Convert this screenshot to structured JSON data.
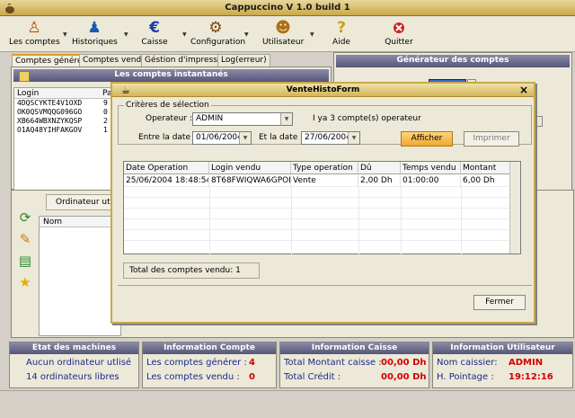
{
  "app": {
    "title": "Cappuccino V 1.0 build 1"
  },
  "toolbar": {
    "items": [
      {
        "label": "Les comptes",
        "icon": "people-icon"
      },
      {
        "label": "Historiques",
        "icon": "history-icon"
      },
      {
        "label": "Caisse",
        "icon": "euro-icon"
      },
      {
        "label": "Configuration",
        "icon": "config-icon"
      },
      {
        "label": "Utilisateur",
        "icon": "user-icon"
      },
      {
        "label": "Aide",
        "icon": "help-icon"
      },
      {
        "label": "Quitter",
        "icon": "quit-icon"
      }
    ]
  },
  "left_tabs": [
    "Comptes générer",
    "Comptes vendu",
    "Géstion d'impression",
    "Log(erreur)"
  ],
  "accounts_panel": {
    "title": "Les comptes instantanés",
    "columns": [
      "Login",
      "Pa"
    ],
    "rows": [
      "4DQSCYKTE4V1OXD",
      "OK0QSVMQQG096GO",
      "XB664WBXNZYKQSP",
      "O1AQ48YIHFAKGOV"
    ],
    "pass_fragments": [
      "9",
      "0",
      "2",
      "1"
    ]
  },
  "generator_panel": {
    "title": "Générateur des comptes"
  },
  "machines_panel": {
    "tab": "Ordinateur utilisé",
    "column": "Nom"
  },
  "status": {
    "machines": {
      "title": "Etat des machines",
      "line1": "Aucun ordinateur utlisé",
      "line2": "14 ordinateurs libres"
    },
    "compte": {
      "title": "Information Compte",
      "label1": "Les comptes générer :",
      "value1": "4",
      "label2": "Les comptes vendu :",
      "value2": "0"
    },
    "caisse": {
      "title": "Information Caisse",
      "label1": "Total Montant caisse :",
      "value1": "00,00 Dh",
      "label2": "Total Crédit :",
      "value2": "00,00 Dh"
    },
    "utilisateur": {
      "title": "Information Utilisateur",
      "label1": "Nom caissier:",
      "value1": "ADMIN",
      "label2": "H. Pointage :",
      "value2": "19:12:16"
    }
  },
  "dialog": {
    "title": "VenteHistoForm",
    "criteria_legend": "Critères de sélection",
    "operator_label": "Operateur :",
    "operator_value": "ADMIN",
    "operator_info": "I ya 3 compte(s) operateur",
    "from_label": "Entre la date :",
    "from_value": "01/06/2004",
    "to_label": "Et la date :",
    "to_value": "27/06/2004",
    "show_button": "Afficher",
    "print_button": "Imprimer",
    "columns": [
      "Date Operation",
      "Login vendu",
      "Type operation",
      "Dû",
      "Temps vendu",
      "Montant"
    ],
    "rows": [
      [
        "25/06/2004 18:48:54",
        "8T68FWIQWA6GPOI",
        "Vente",
        "2,00 Dh",
        "01:00:00",
        "6,00 Dh"
      ]
    ],
    "total_text": "Total des comptes vendu: 1",
    "close_button": "Fermer"
  }
}
